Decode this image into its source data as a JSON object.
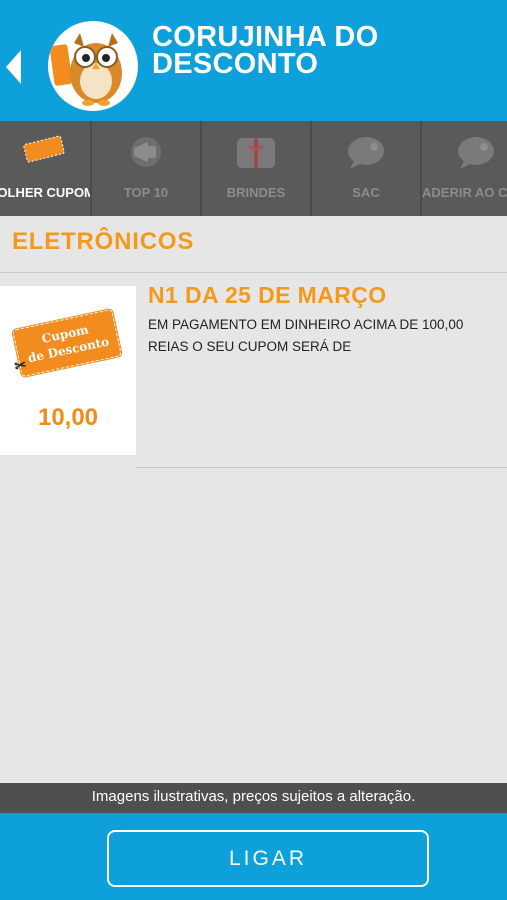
{
  "header": {
    "title": "CORUJINHA DO DESCONTO",
    "back_icon": "chevron-left-icon",
    "logo_icon": "owl-logo"
  },
  "tabs": [
    {
      "label": "COLHER CUPOM",
      "icon": "coupon-icon",
      "active": true
    },
    {
      "label": "TOP 10",
      "icon": "megaphone-icon",
      "active": false
    },
    {
      "label": "BRINDES",
      "icon": "gift-icon",
      "active": false
    },
    {
      "label": "SAC",
      "icon": "chat-icon",
      "active": false
    },
    {
      "label": "ADERIR AO CUPOM",
      "icon": "chat-icon",
      "active": false
    }
  ],
  "section": {
    "title": "ELETRÔNICOS"
  },
  "offer": {
    "coupon_text_line1": "Cupom",
    "coupon_text_line2": "de Desconto",
    "price": "10,00",
    "title": "N1 DA 25 DE MARÇO",
    "description": "EM PAGAMENTO EM DINHEIRO ACIMA DE 100,00 REIAS O SEU CUPOM SERÁ DE"
  },
  "disclaimer": "Imagens ilustrativas, preços sujeitos a alteração.",
  "footer": {
    "call_label": "LIGAR"
  },
  "colors": {
    "primary": "#0ea0da",
    "accent": "#f39a1e",
    "tabbar": "#5a5a5a",
    "background": "#e6e6e6"
  }
}
